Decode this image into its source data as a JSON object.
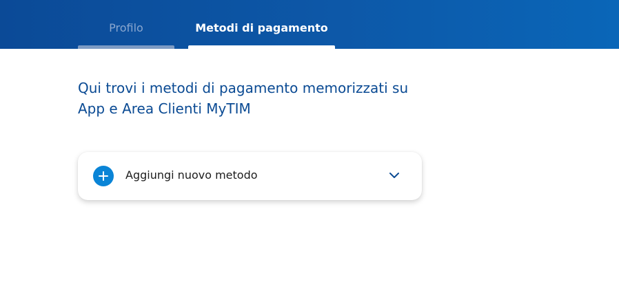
{
  "tabs": [
    {
      "label": "Profilo",
      "active": false
    },
    {
      "label": "Metodi di pagamento",
      "active": true
    }
  ],
  "intro_line1": "Qui trovi i metodi di pagamento memorizzati su",
  "intro_line2": "App e Area Clienti MyTIM",
  "add_method": {
    "label": "Aggiungi nuovo metodo",
    "icon": "plus-icon",
    "toggle_icon": "chevron-down-icon"
  },
  "colors": {
    "header": "#0b4a97",
    "accent": "#0a84d6",
    "intro_text": "#0a4a93"
  }
}
